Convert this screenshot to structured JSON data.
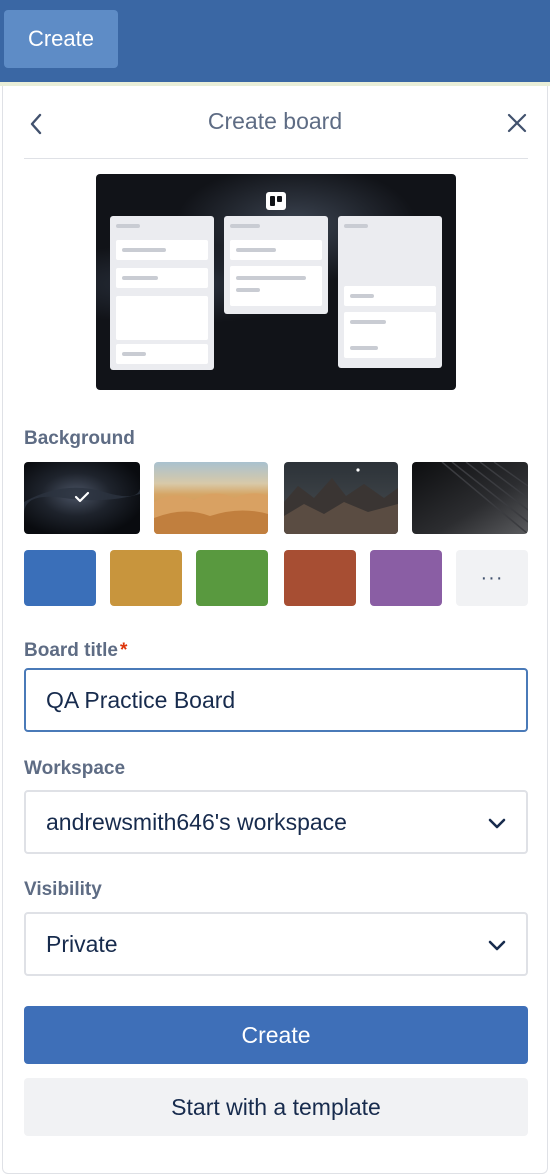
{
  "topbar": {
    "create_label": "Create"
  },
  "panel": {
    "title": "Create board"
  },
  "background": {
    "label": "Background",
    "photos": [
      {
        "name": "dark-abstract",
        "selected": true
      },
      {
        "name": "desert-dunes",
        "selected": false
      },
      {
        "name": "mountain-night",
        "selected": false
      },
      {
        "name": "dark-lines",
        "selected": false
      }
    ],
    "colors": [
      "#3a6fb9",
      "#c8953d",
      "#59993f",
      "#a74e33",
      "#8a5ea4"
    ],
    "more_label": "···"
  },
  "board_title": {
    "label": "Board title",
    "required_mark": "*",
    "value": "QA Practice Board"
  },
  "workspace": {
    "label": "Workspace",
    "value": "andrewsmith646's workspace"
  },
  "visibility": {
    "label": "Visibility",
    "value": "Private"
  },
  "actions": {
    "create_label": "Create",
    "template_label": "Start with a template"
  }
}
